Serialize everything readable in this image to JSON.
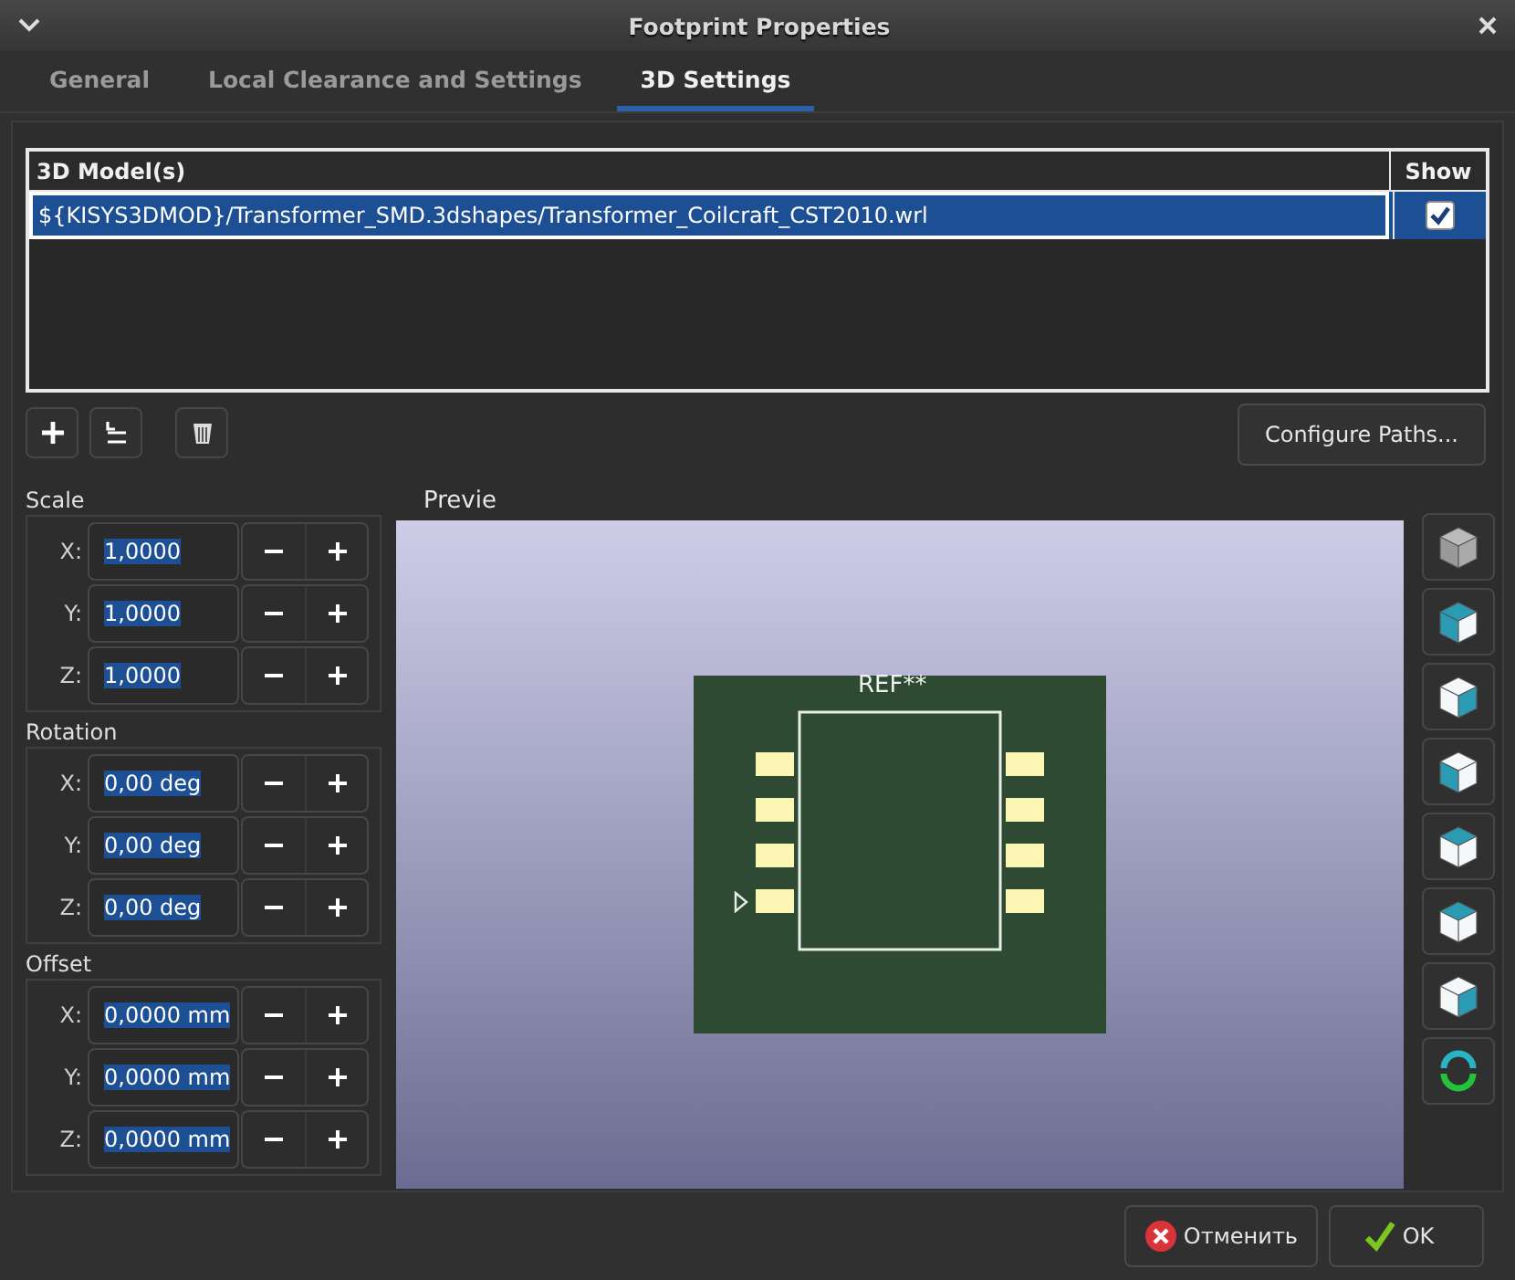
{
  "window": {
    "title": "Footprint Properties"
  },
  "tabs": [
    {
      "label": "General",
      "selected": false
    },
    {
      "label": "Local Clearance and Settings",
      "selected": false
    },
    {
      "label": "3D Settings",
      "selected": true
    }
  ],
  "models_table": {
    "columns": [
      "3D Model(s)",
      "Show"
    ],
    "rows": [
      {
        "path": "${KISYS3DMOD}/Transformer_SMD.3dshapes/Transformer_Coilcraft_CST2010.wrl",
        "show": true,
        "selected": true
      }
    ]
  },
  "configure_button": "Configure Paths...",
  "groups": [
    {
      "title": "Scale",
      "fields": [
        {
          "axis": "X:",
          "value": "1,0000"
        },
        {
          "axis": "Y:",
          "value": "1,0000"
        },
        {
          "axis": "Z:",
          "value": "1,0000"
        }
      ]
    },
    {
      "title": "Rotation",
      "fields": [
        {
          "axis": "X:",
          "value": "0,00 deg"
        },
        {
          "axis": "Y:",
          "value": "0,00 deg"
        },
        {
          "axis": "Z:",
          "value": "0,00 deg"
        }
      ]
    },
    {
      "title": "Offset",
      "fields": [
        {
          "axis": "X:",
          "value": "0,0000 mm"
        },
        {
          "axis": "Y:",
          "value": "0,0000 mm"
        },
        {
          "axis": "Z:",
          "value": "0,0000 mm"
        }
      ]
    }
  ],
  "preview": {
    "title": "Previe",
    "reference_label": "REF**"
  },
  "buttons": [
    {
      "label": "Отменить",
      "kind": "cancel"
    },
    {
      "label": "OK",
      "kind": "ok"
    }
  ]
}
